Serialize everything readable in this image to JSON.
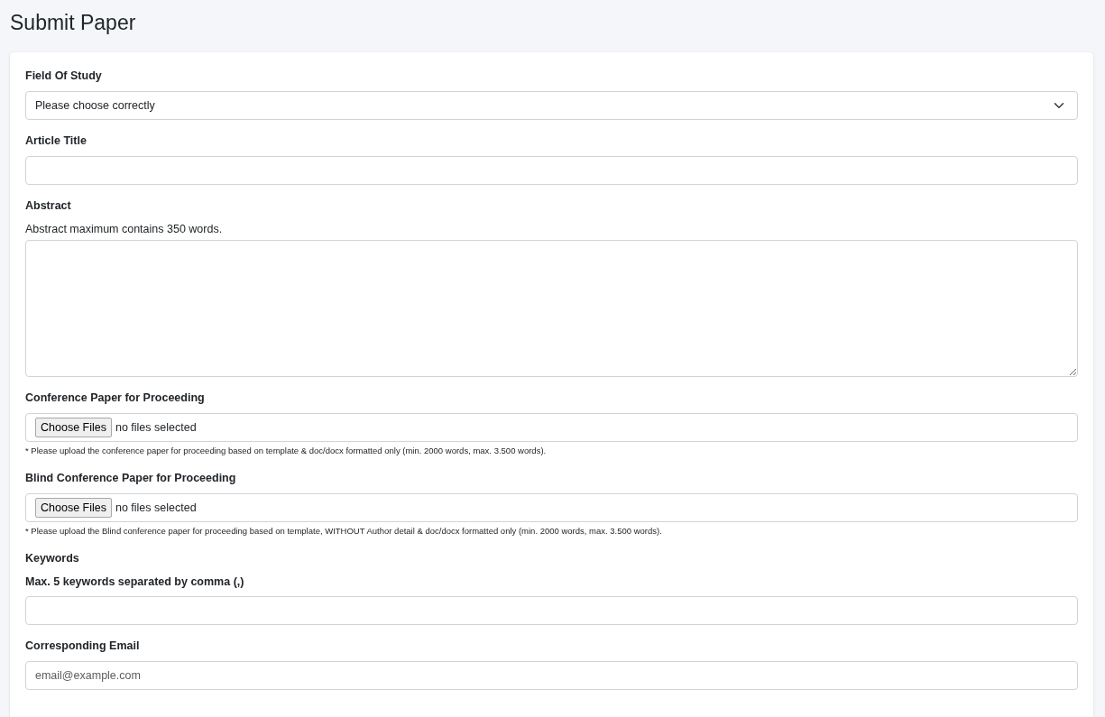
{
  "page_title": "Submit Paper",
  "fields": [
    {
      "kind": "select",
      "label": "Field Of Study",
      "value": "Please choose correctly"
    },
    {
      "kind": "text",
      "label": "Article Title"
    },
    {
      "kind": "textarea",
      "label": "Abstract",
      "help": "Abstract maximum contains 350 words.",
      "help_bold": false
    },
    {
      "kind": "file",
      "label": "Conference Paper for Proceeding",
      "button": "Choose Files",
      "status": "no files selected",
      "note": "* Please upload the conference paper for proceeding based on template & doc/docx formatted only (min. 2000 words, max. 3.500 words)."
    },
    {
      "kind": "file",
      "label": "Blind Conference Paper for Proceeding",
      "button": "Choose Files",
      "status": "no files selected",
      "note": "* Please upload the Blind conference paper for proceeding based on template, WITHOUT Author detail & doc/docx formatted only (min. 2000 words, max. 3.500 words)."
    },
    {
      "kind": "text",
      "label": "Keywords",
      "help": "Max. 5 keywords separated by comma (,)",
      "help_bold": true
    },
    {
      "kind": "email",
      "label": "Corresponding Email",
      "placeholder": "email@example.com"
    }
  ]
}
